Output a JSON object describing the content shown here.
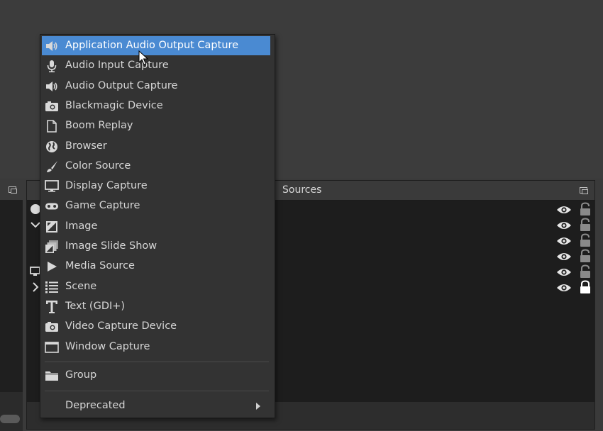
{
  "sources_dock": {
    "title": "Sources",
    "rows": [
      {
        "visible": true,
        "locked": false
      },
      {
        "visible": true,
        "locked": false
      },
      {
        "visible": true,
        "locked": false
      },
      {
        "visible": true,
        "locked": false
      },
      {
        "visible": true,
        "locked": false
      },
      {
        "visible": true,
        "locked": true
      }
    ]
  },
  "menu": {
    "items": [
      {
        "label": "Application Audio Output Capture",
        "icon": "speaker-icon",
        "active": true
      },
      {
        "label": "Audio Input Capture",
        "icon": "microphone-icon"
      },
      {
        "label": "Audio Output Capture",
        "icon": "speaker-icon"
      },
      {
        "label": "Blackmagic Device",
        "icon": "camera-icon"
      },
      {
        "label": "Boom Replay",
        "icon": "file-icon"
      },
      {
        "label": "Browser",
        "icon": "globe-icon"
      },
      {
        "label": "Color Source",
        "icon": "paintbrush-icon"
      },
      {
        "label": "Display Capture",
        "icon": "monitor-icon"
      },
      {
        "label": "Game Capture",
        "icon": "gamepad-icon"
      },
      {
        "label": "Image",
        "icon": "image-icon"
      },
      {
        "label": "Image Slide Show",
        "icon": "slideshow-icon"
      },
      {
        "label": "Media Source",
        "icon": "play-icon"
      },
      {
        "label": "Scene",
        "icon": "list-icon"
      },
      {
        "label": "Text (GDI+)",
        "icon": "text-icon"
      },
      {
        "label": "Video Capture Device",
        "icon": "camera-icon"
      },
      {
        "label": "Window Capture",
        "icon": "window-icon"
      }
    ],
    "group_label": "Group",
    "deprecated_label": "Deprecated"
  },
  "colors": {
    "menu_bg": "#333333",
    "highlight": "#4a8ad2",
    "panel_bg": "#1d1d1d"
  }
}
